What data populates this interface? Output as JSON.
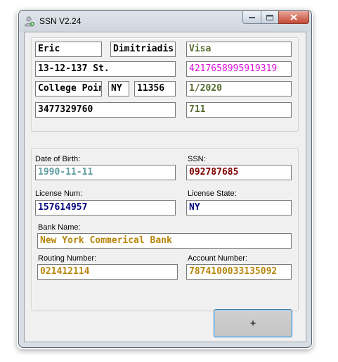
{
  "window": {
    "title": "SSN V2.24"
  },
  "card": {
    "first_name": "Eric",
    "last_name": "Dimitriadis",
    "card_type": "Visa",
    "street": "13-12-137 St.",
    "card_number": "4217658995919319",
    "city": "College Point",
    "state": "NY",
    "zip": "11356",
    "expiry": "1/2020",
    "phone": "3477329760",
    "cvv": "711"
  },
  "details": {
    "dob_label": "Date of Birth:",
    "dob": "1990-11-11",
    "ssn_label": "SSN:",
    "ssn": "092787685",
    "license_num_label": "License Num:",
    "license_num": "157614957",
    "license_state_label": "License State:",
    "license_state": "NY",
    "bank_name_label": "Bank Name:",
    "bank_name": "New York Commerical Bank",
    "routing_label": "Routing Number:",
    "routing": "021412114",
    "account_label": "Account Number:",
    "account": "7874100033135092"
  },
  "actions": {
    "add_label": "+"
  },
  "colors": {
    "card_green": "#556b2f",
    "card_magenta": "#dd10dd",
    "dob_teal": "#5f9ea0",
    "ssn_maroon": "#800000",
    "license_navy": "#000080",
    "bank_gold": "#b8860b"
  }
}
